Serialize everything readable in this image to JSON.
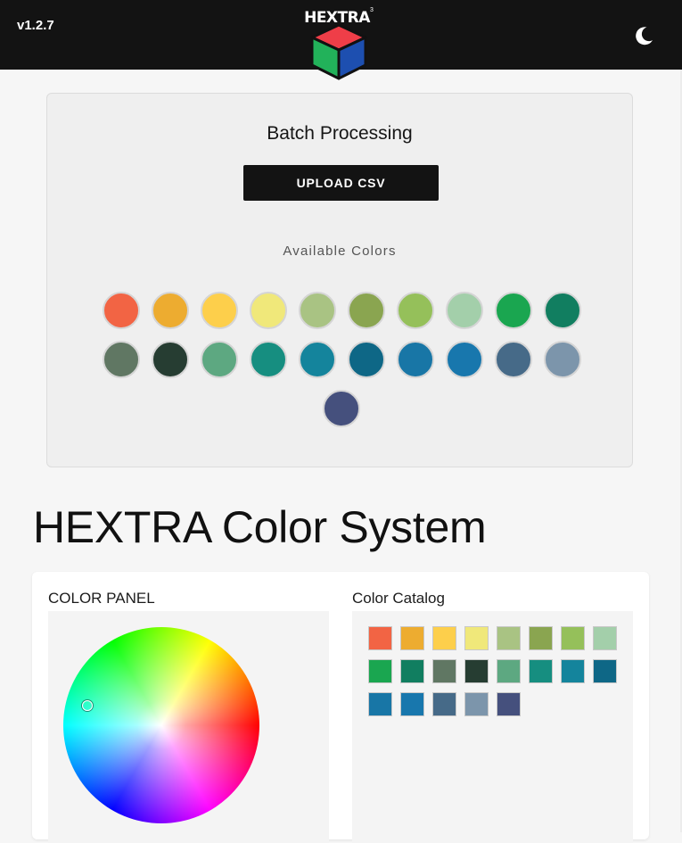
{
  "header": {
    "version": "v1.2.7",
    "logo_text": "HEXTRA",
    "logo_superscript": "3",
    "theme_toggle_icon": "moon-icon",
    "background": "#131313"
  },
  "batch": {
    "title": "Batch Processing",
    "upload_label": "UPLOAD CSV",
    "available_label": "Available Colors",
    "colors": [
      "#F26444",
      "#EDAC30",
      "#FDCF4B",
      "#F0E87A",
      "#A9C383",
      "#8AA550",
      "#95C05A",
      "#A3CFAA",
      "#1AA650",
      "#117E60",
      "#607763",
      "#263D32",
      "#5DA881",
      "#168E80",
      "#14849C",
      "#0E6786",
      "#1876A6",
      "#1877AD",
      "#466A88",
      "#7C95AB",
      "#45507D"
    ]
  },
  "page_title": "HEXTRA Color System",
  "panel": {
    "label": "COLOR PANEL"
  },
  "catalog": {
    "label": "Color Catalog",
    "colors": [
      "#F26444",
      "#EDAC30",
      "#FDCF4B",
      "#F0E87A",
      "#A9C383",
      "#8AA550",
      "#95C05A",
      "#A3CFAA",
      "#1AA650",
      "#117E60",
      "#607763",
      "#263D32",
      "#5DA881",
      "#168E80",
      "#14849C",
      "#0E6786",
      "#1876A6",
      "#1877AD",
      "#466A88",
      "#7C95AB",
      "#45507D"
    ]
  }
}
